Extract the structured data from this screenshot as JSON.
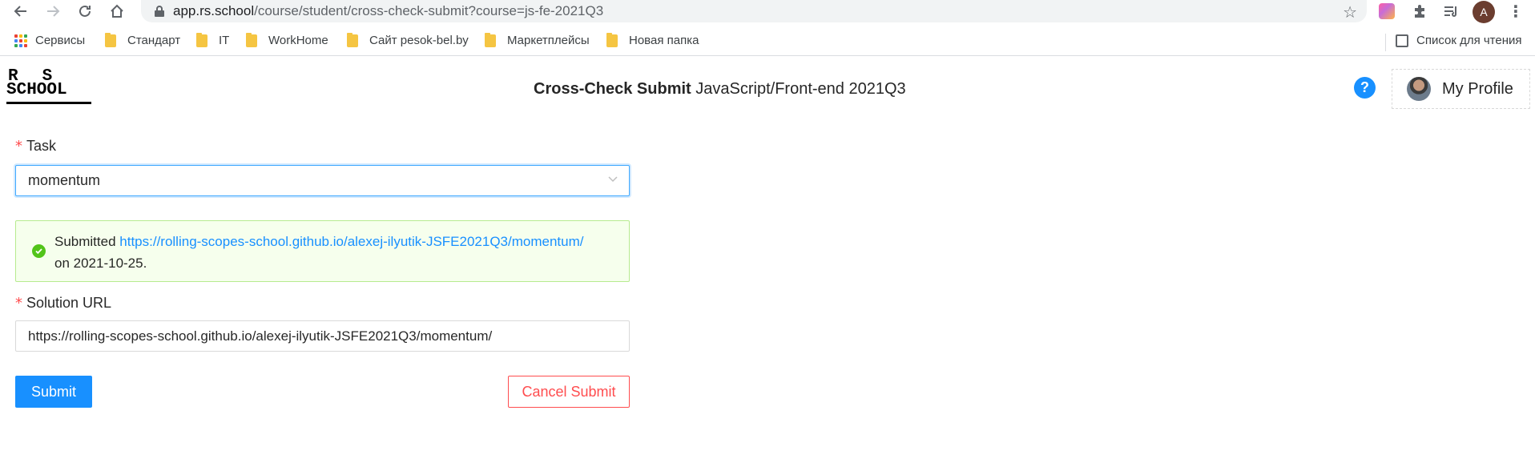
{
  "browser": {
    "url_host": "app.rs.school",
    "url_path": "/course/student/cross-check-submit?course=js-fe-2021Q3",
    "avatar_letter": "A",
    "bookmarks": [
      {
        "label": "Сервисы",
        "icon": "apps-grid-icon"
      },
      {
        "label": "Стандарт",
        "icon": "folder-icon"
      },
      {
        "label": "IT",
        "icon": "folder-icon"
      },
      {
        "label": "WorkHome",
        "icon": "folder-icon"
      },
      {
        "label": "Сайт pesok-bel.by",
        "icon": "folder-icon"
      },
      {
        "label": "Маркетплейсы",
        "icon": "folder-icon"
      },
      {
        "label": "Новая папка",
        "icon": "folder-icon"
      }
    ],
    "reading_list": "Список для чтения"
  },
  "header": {
    "logo_line1": "RS",
    "logo_line2": "SCHOOL",
    "title_bold": "Cross-Check Submit",
    "title_rest": " JavaScript/Front-end 2021Q3",
    "help_label": "?",
    "profile_label": "My Profile"
  },
  "form": {
    "task_label": "Task",
    "task_value": "momentum",
    "alert": {
      "prefix": "Submitted ",
      "link": "https://rolling-scopes-school.github.io/alexej-ilyutik-JSFE2021Q3/momentum/",
      "suffix": "on 2021-10-25."
    },
    "solution_label": "Solution URL",
    "solution_value": "https://rolling-scopes-school.github.io/alexej-ilyutik-JSFE2021Q3/momentum/",
    "submit_label": "Submit",
    "cancel_label": "Cancel Submit"
  },
  "colors": {
    "primary": "#1890ff",
    "danger": "#ff4d4f",
    "success": "#52c41a",
    "success_bg": "#f6ffed"
  }
}
